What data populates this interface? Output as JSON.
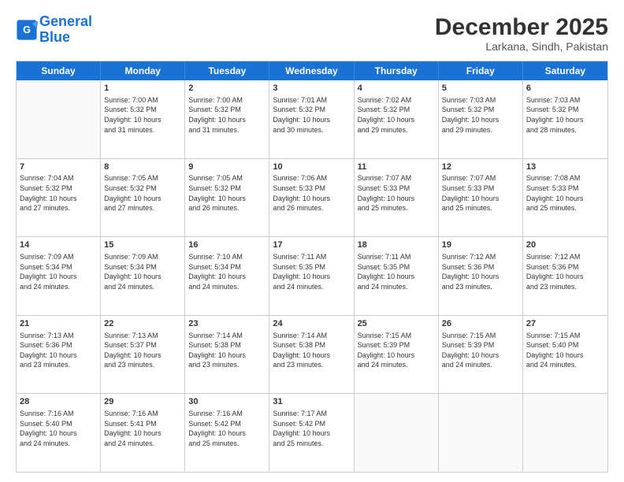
{
  "header": {
    "logo_line1": "General",
    "logo_line2": "Blue",
    "title": "December 2025",
    "subtitle": "Larkana, Sindh, Pakistan"
  },
  "days_of_week": [
    "Sunday",
    "Monday",
    "Tuesday",
    "Wednesday",
    "Thursday",
    "Friday",
    "Saturday"
  ],
  "weeks": [
    [
      {
        "day": "",
        "info": ""
      },
      {
        "day": "1",
        "info": "Sunrise: 7:00 AM\nSunset: 5:32 PM\nDaylight: 10 hours\nand 31 minutes."
      },
      {
        "day": "2",
        "info": "Sunrise: 7:00 AM\nSunset: 5:32 PM\nDaylight: 10 hours\nand 31 minutes."
      },
      {
        "day": "3",
        "info": "Sunrise: 7:01 AM\nSunset: 5:32 PM\nDaylight: 10 hours\nand 30 minutes."
      },
      {
        "day": "4",
        "info": "Sunrise: 7:02 AM\nSunset: 5:32 PM\nDaylight: 10 hours\nand 29 minutes."
      },
      {
        "day": "5",
        "info": "Sunrise: 7:03 AM\nSunset: 5:32 PM\nDaylight: 10 hours\nand 29 minutes."
      },
      {
        "day": "6",
        "info": "Sunrise: 7:03 AM\nSunset: 5:32 PM\nDaylight: 10 hours\nand 28 minutes."
      }
    ],
    [
      {
        "day": "7",
        "info": "Sunrise: 7:04 AM\nSunset: 5:32 PM\nDaylight: 10 hours\nand 27 minutes."
      },
      {
        "day": "8",
        "info": "Sunrise: 7:05 AM\nSunset: 5:32 PM\nDaylight: 10 hours\nand 27 minutes."
      },
      {
        "day": "9",
        "info": "Sunrise: 7:05 AM\nSunset: 5:32 PM\nDaylight: 10 hours\nand 26 minutes."
      },
      {
        "day": "10",
        "info": "Sunrise: 7:06 AM\nSunset: 5:33 PM\nDaylight: 10 hours\nand 26 minutes."
      },
      {
        "day": "11",
        "info": "Sunrise: 7:07 AM\nSunset: 5:33 PM\nDaylight: 10 hours\nand 25 minutes."
      },
      {
        "day": "12",
        "info": "Sunrise: 7:07 AM\nSunset: 5:33 PM\nDaylight: 10 hours\nand 25 minutes."
      },
      {
        "day": "13",
        "info": "Sunrise: 7:08 AM\nSunset: 5:33 PM\nDaylight: 10 hours\nand 25 minutes."
      }
    ],
    [
      {
        "day": "14",
        "info": "Sunrise: 7:09 AM\nSunset: 5:34 PM\nDaylight: 10 hours\nand 24 minutes."
      },
      {
        "day": "15",
        "info": "Sunrise: 7:09 AM\nSunset: 5:34 PM\nDaylight: 10 hours\nand 24 minutes."
      },
      {
        "day": "16",
        "info": "Sunrise: 7:10 AM\nSunset: 5:34 PM\nDaylight: 10 hours\nand 24 minutes."
      },
      {
        "day": "17",
        "info": "Sunrise: 7:11 AM\nSunset: 5:35 PM\nDaylight: 10 hours\nand 24 minutes."
      },
      {
        "day": "18",
        "info": "Sunrise: 7:11 AM\nSunset: 5:35 PM\nDaylight: 10 hours\nand 24 minutes."
      },
      {
        "day": "19",
        "info": "Sunrise: 7:12 AM\nSunset: 5:36 PM\nDaylight: 10 hours\nand 23 minutes."
      },
      {
        "day": "20",
        "info": "Sunrise: 7:12 AM\nSunset: 5:36 PM\nDaylight: 10 hours\nand 23 minutes."
      }
    ],
    [
      {
        "day": "21",
        "info": "Sunrise: 7:13 AM\nSunset: 5:36 PM\nDaylight: 10 hours\nand 23 minutes."
      },
      {
        "day": "22",
        "info": "Sunrise: 7:13 AM\nSunset: 5:37 PM\nDaylight: 10 hours\nand 23 minutes."
      },
      {
        "day": "23",
        "info": "Sunrise: 7:14 AM\nSunset: 5:38 PM\nDaylight: 10 hours\nand 23 minutes."
      },
      {
        "day": "24",
        "info": "Sunrise: 7:14 AM\nSunset: 5:38 PM\nDaylight: 10 hours\nand 23 minutes."
      },
      {
        "day": "25",
        "info": "Sunrise: 7:15 AM\nSunset: 5:39 PM\nDaylight: 10 hours\nand 24 minutes."
      },
      {
        "day": "26",
        "info": "Sunrise: 7:15 AM\nSunset: 5:39 PM\nDaylight: 10 hours\nand 24 minutes."
      },
      {
        "day": "27",
        "info": "Sunrise: 7:15 AM\nSunset: 5:40 PM\nDaylight: 10 hours\nand 24 minutes."
      }
    ],
    [
      {
        "day": "28",
        "info": "Sunrise: 7:16 AM\nSunset: 5:40 PM\nDaylight: 10 hours\nand 24 minutes."
      },
      {
        "day": "29",
        "info": "Sunrise: 7:16 AM\nSunset: 5:41 PM\nDaylight: 10 hours\nand 24 minutes."
      },
      {
        "day": "30",
        "info": "Sunrise: 7:16 AM\nSunset: 5:42 PM\nDaylight: 10 hours\nand 25 minutes."
      },
      {
        "day": "31",
        "info": "Sunrise: 7:17 AM\nSunset: 5:42 PM\nDaylight: 10 hours\nand 25 minutes."
      },
      {
        "day": "",
        "info": ""
      },
      {
        "day": "",
        "info": ""
      },
      {
        "day": "",
        "info": ""
      }
    ]
  ]
}
